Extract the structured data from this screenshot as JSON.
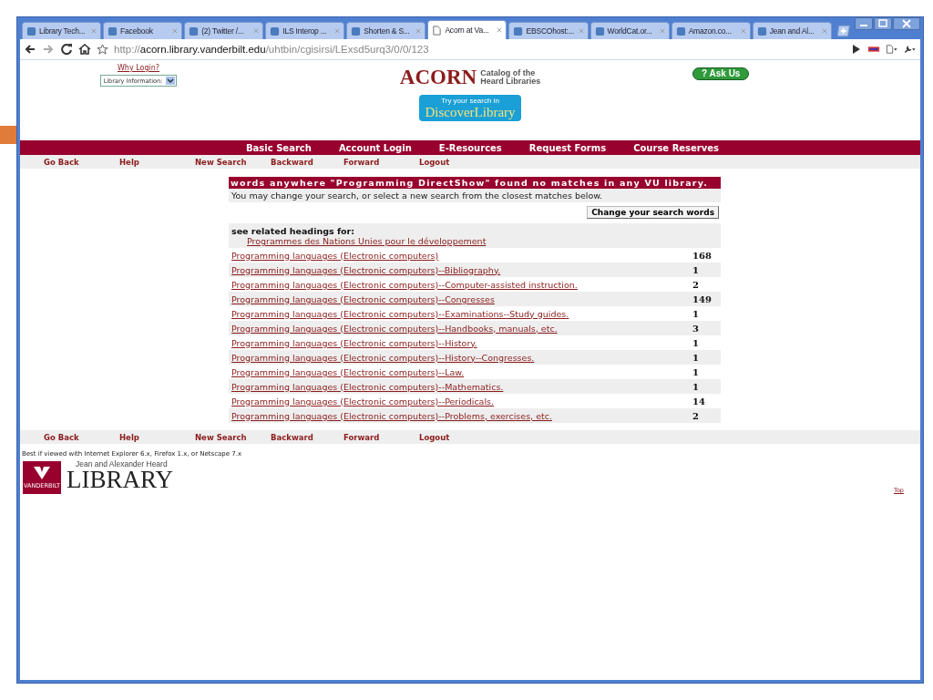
{
  "browser": {
    "tabs": [
      {
        "title": "Library Tech...",
        "selected": false
      },
      {
        "title": "Facebook",
        "selected": false
      },
      {
        "title": "(2) Twitter /...",
        "selected": false
      },
      {
        "title": "ILS Interop ...",
        "selected": false
      },
      {
        "title": "Shorten & S...",
        "selected": false
      },
      {
        "title": "Acorn at Va...",
        "selected": true
      },
      {
        "title": "EBSCOhost:...",
        "selected": false
      },
      {
        "title": "WorldCat.or...",
        "selected": false
      },
      {
        "title": "Amazon.co...",
        "selected": false
      },
      {
        "title": "Jean and Al...",
        "selected": false
      }
    ],
    "address": {
      "scheme": "http://",
      "host": "acorn.library.vanderbilt.edu",
      "path": "/uhtbin/cgisirsi/LExsd5urq3/0/0/123"
    }
  },
  "header": {
    "why_login": "Why Login?",
    "library_select": "Library Information:",
    "logo": {
      "name": "ACORN",
      "tagline_1": "Catalog of the",
      "tagline_2": "Heard Libraries"
    },
    "discover": {
      "line_1": "Try your search in",
      "line_2": "DiscoverLibrary"
    },
    "ask_us": "? Ask Us"
  },
  "main_nav": [
    "Basic Search",
    "Account Login",
    "E-Resources",
    "Request Forms",
    "Course Reserves"
  ],
  "sub_nav": [
    "Go Back",
    "Help",
    "New Search",
    "Backward",
    "Forward",
    "Logout"
  ],
  "results": {
    "message": "words anywhere \"Programming DirectShow\" found no matches in any VU library.",
    "hint": "You may change your search, or select a new search from the closest matches below.",
    "change_button": "Change your search words",
    "related_label": "see related headings for:",
    "related_link": "Programmes des Nations Unies pour le développement",
    "rows": [
      {
        "heading": "Programming languages (Electronic computers)",
        "count": "168"
      },
      {
        "heading": "Programming languages (Electronic computers)--Bibliography.",
        "count": "1"
      },
      {
        "heading": "Programming languages (Electronic computers)--Computer-assisted instruction.",
        "count": "2"
      },
      {
        "heading": "Programming languages (Electronic computers)--Congresses",
        "count": "149"
      },
      {
        "heading": "Programming languages (Electronic computers)--Examinations--Study guides.",
        "count": "1"
      },
      {
        "heading": "Programming languages (Electronic computers)--Handbooks, manuals, etc.",
        "count": "3"
      },
      {
        "heading": "Programming languages (Electronic computers)--History.",
        "count": "1"
      },
      {
        "heading": "Programming languages (Electronic computers)--History--Congresses.",
        "count": "1"
      },
      {
        "heading": "Programming languages (Electronic computers)--Law.",
        "count": "1"
      },
      {
        "heading": "Programming languages (Electronic computers)--Mathematics.",
        "count": "1"
      },
      {
        "heading": "Programming languages (Electronic computers)--Periodicals.",
        "count": "14"
      },
      {
        "heading": "Programming languages (Electronic computers)--Problems, exercises, etc.",
        "count": "2"
      }
    ]
  },
  "footer_nav": [
    "Go Back",
    "Help",
    "New Search",
    "Backward",
    "Forward",
    "Logout"
  ],
  "footer": {
    "browser_note": "Best if viewed with Internet Explorer 6.x, Firefox 1.x, or Netscape 7.x",
    "logo": {
      "line_1": "Jean and Alexander Heard",
      "line_2": "LIBRARY",
      "seal": "VANDERBILT"
    },
    "top_link": "Top"
  }
}
